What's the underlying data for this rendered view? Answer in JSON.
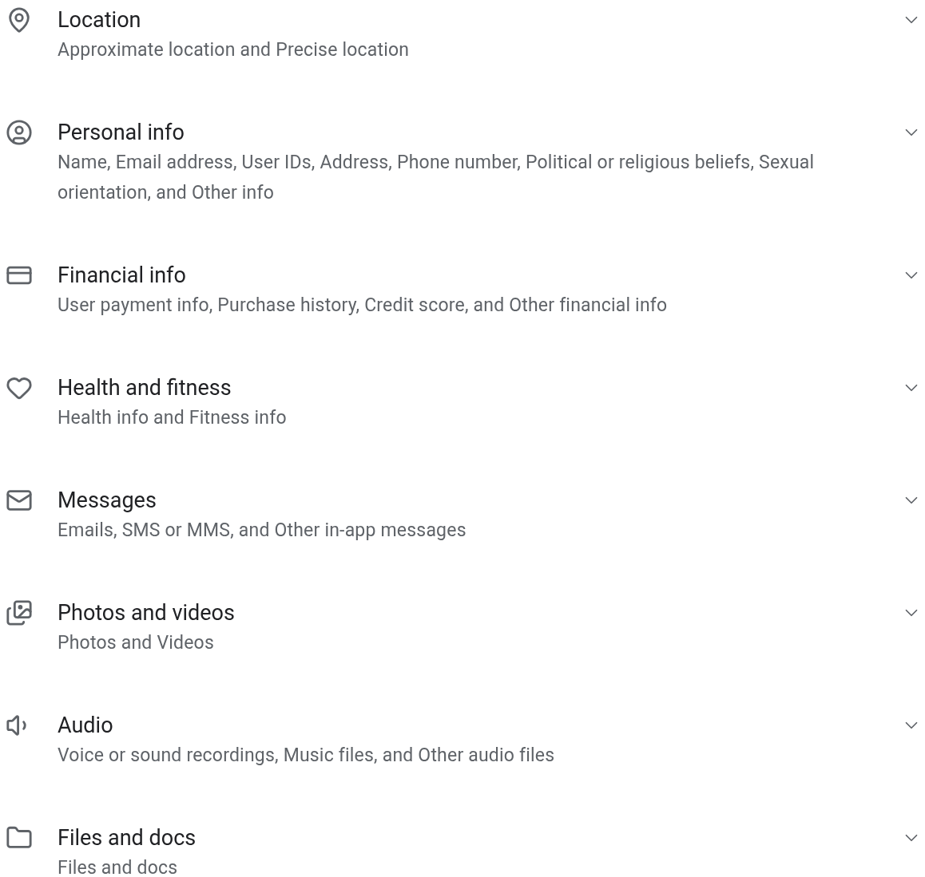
{
  "sections": [
    {
      "kind": "location",
      "title": "Location",
      "description": "Approximate location and Precise location",
      "expanded": false
    },
    {
      "kind": "personal",
      "title": "Personal info",
      "description": "Name, Email address, User IDs, Address, Phone number, Political or religious beliefs, Sexual orientation, and Other info",
      "expanded": false
    },
    {
      "kind": "financial",
      "title": "Financial info",
      "description": "User payment info, Purchase history, Credit score, and Other financial info",
      "expanded": false
    },
    {
      "kind": "health",
      "title": "Health and fitness",
      "description": "Health info and Fitness info",
      "expanded": false
    },
    {
      "kind": "messages",
      "title": "Messages",
      "description": "Emails, SMS or MMS, and Other in-app messages",
      "expanded": false
    },
    {
      "kind": "photos",
      "title": "Photos and videos",
      "description": "Photos and Videos",
      "expanded": false
    },
    {
      "kind": "audio",
      "title": "Audio",
      "description": "Voice or sound recordings, Music files, and Other audio files",
      "expanded": false
    },
    {
      "kind": "files",
      "title": "Files and docs",
      "description": "Files and docs",
      "expanded": false
    }
  ]
}
